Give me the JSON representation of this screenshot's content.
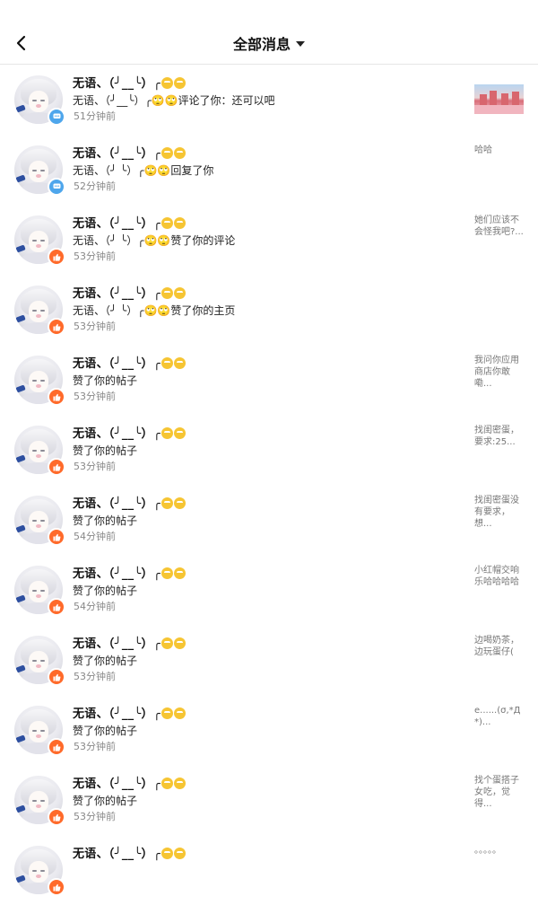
{
  "header": {
    "title": "全部消息",
    "back_icon": "chevron-left-icon",
    "dropdown_icon": "caret-down-icon"
  },
  "colors": {
    "comment_badge": "#4ea6ec",
    "like_badge": "#ff6a2a",
    "time_text": "#888888"
  },
  "notifications": [
    {
      "name": "无语、（╯__╰）╭",
      "action": "无语、（╯__╰）╭🙄🙄评论了你：还可以吧",
      "time": "51分钟前",
      "badge": "comment",
      "preview": "",
      "thumbnail": "photo"
    },
    {
      "name": "无语、（╯__╰）╭",
      "action": "无语、（╯ ╰）╭🙄🙄回复了你",
      "time": "52分钟前",
      "badge": "comment",
      "preview": "哈哈"
    },
    {
      "name": "无语、（╯__╰）╭",
      "action": "无语、（╯ ╰）╭🙄🙄赞了你的评论",
      "time": "53分钟前",
      "badge": "like",
      "preview": "她们应该不会怪我吧?..."
    },
    {
      "name": "无语、（╯__╰）╭",
      "action": "无语、（╯ ╰）╭🙄🙄赞了你的主页",
      "time": "53分钟前",
      "badge": "like",
      "preview": ""
    },
    {
      "name": "无语、（╯__╰）╭",
      "action": "赞了你的帖子",
      "time": "53分钟前",
      "badge": "like",
      "preview": "我问你应用商店你敢嘞..."
    },
    {
      "name": "无语、（╯__╰）╭",
      "action": "赞了你的帖子",
      "time": "53分钟前",
      "badge": "like",
      "preview": "找闺密蛋，要求:25..."
    },
    {
      "name": "无语、（╯__╰）╭",
      "action": "赞了你的帖子",
      "time": "54分钟前",
      "badge": "like",
      "preview": "找闺密蛋没有要求，想..."
    },
    {
      "name": "无语、（╯__╰）╭",
      "action": "赞了你的帖子",
      "time": "54分钟前",
      "badge": "like",
      "preview": "小红帽交响乐哈哈哈哈"
    },
    {
      "name": "无语、（╯__╰）╭",
      "action": "赞了你的帖子",
      "time": "53分钟前",
      "badge": "like",
      "preview": "边喝奶茶，边玩蛋仔("
    },
    {
      "name": "无语、（╯__╰）╭",
      "action": "赞了你的帖子",
      "time": "53分钟前",
      "badge": "like",
      "preview": "e......(σ,*Д*)..."
    },
    {
      "name": "无语、（╯__╰）╭",
      "action": "赞了你的帖子",
      "time": "53分钟前",
      "badge": "like",
      "preview": "找个蛋搭子女吃，觉得..."
    },
    {
      "name": "无语、（╯__╰）╭",
      "action": "",
      "time": "",
      "badge": "like",
      "preview": "。。。。。"
    }
  ]
}
